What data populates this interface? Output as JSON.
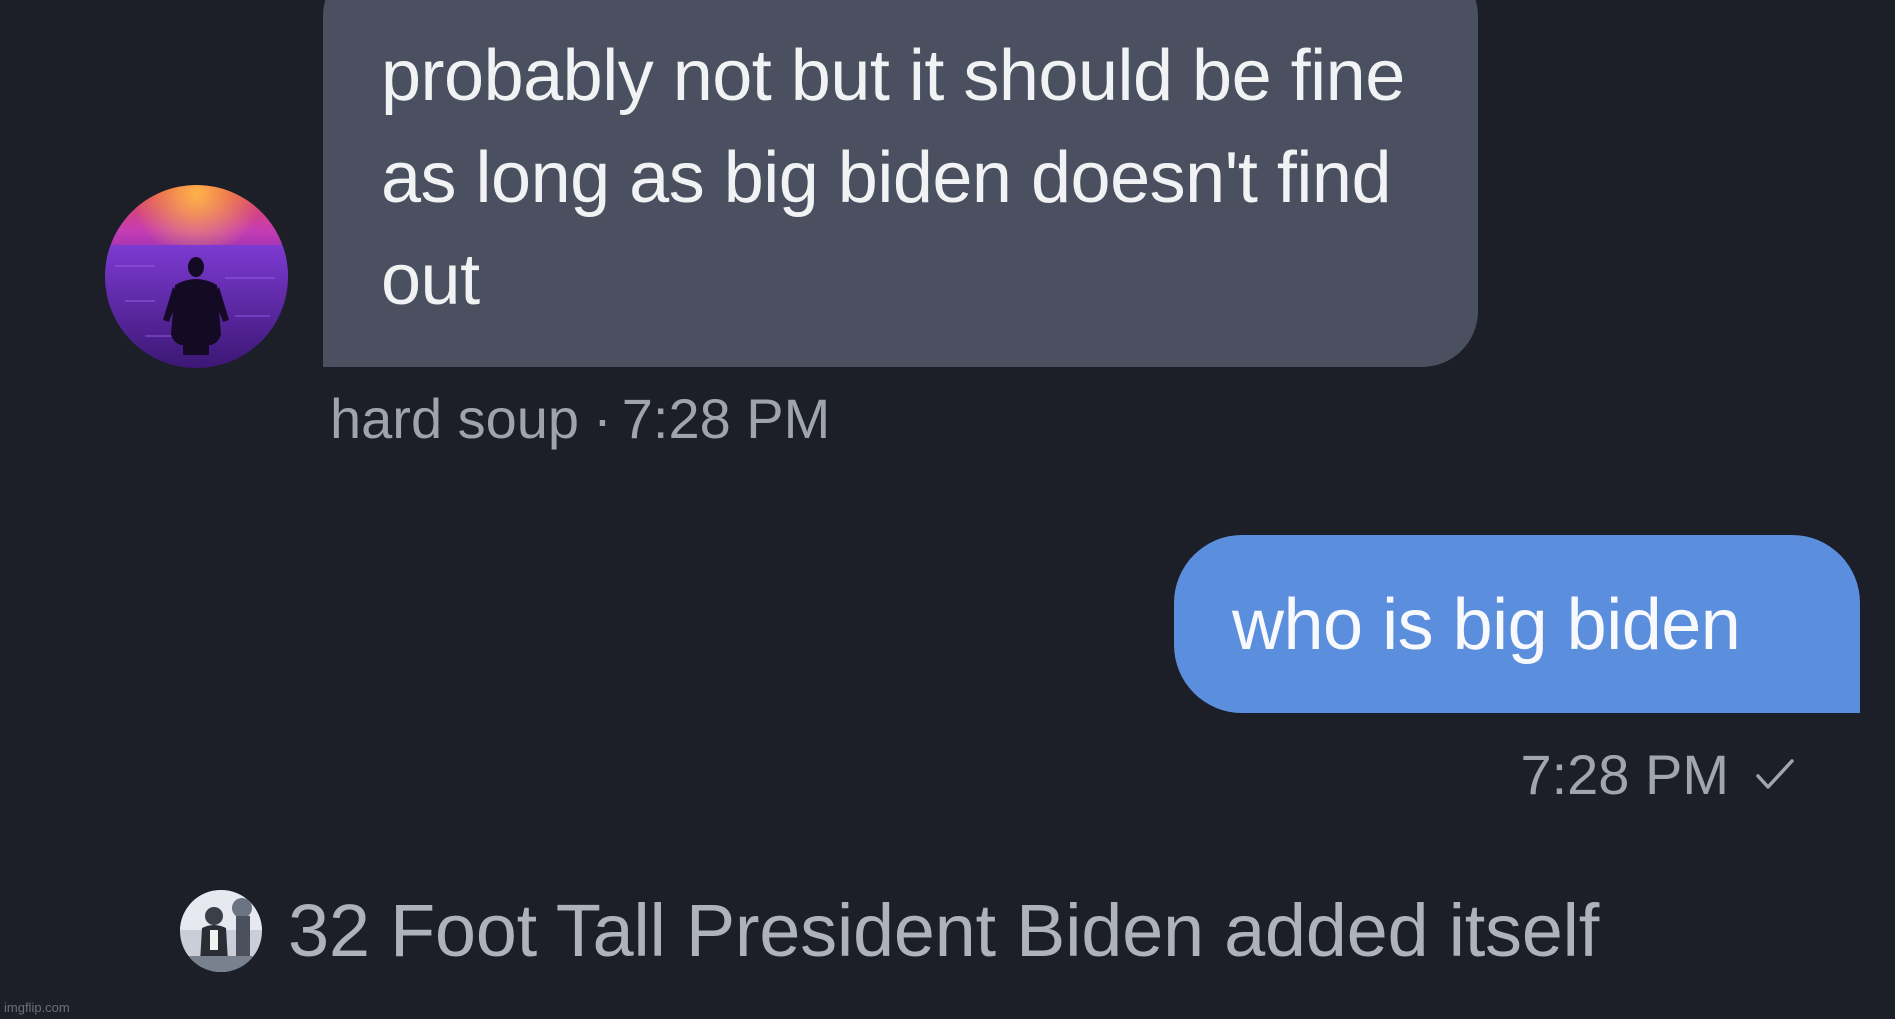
{
  "incoming_message": {
    "text": "probably not but it should be fine as long as big biden doesn't find out",
    "sender": "hard soup",
    "separator": "·",
    "time": "7:28 PM",
    "avatar_icon": "sunset-silhouette-avatar-icon",
    "bubble_color": "#4a5060"
  },
  "outgoing_message": {
    "text": "who is big biden",
    "time": "7:28 PM",
    "status_icon": "check-icon",
    "bubble_color": "#5b8fde"
  },
  "system_event": {
    "text": "32 Foot Tall President Biden added itself",
    "avatar_icon": "person-avatar-icon"
  },
  "watermark": {
    "text": "imgflip.com"
  },
  "colors": {
    "background": "#1c1f28",
    "meta_text": "#9ea3ad",
    "accent": "#5b8fde"
  }
}
